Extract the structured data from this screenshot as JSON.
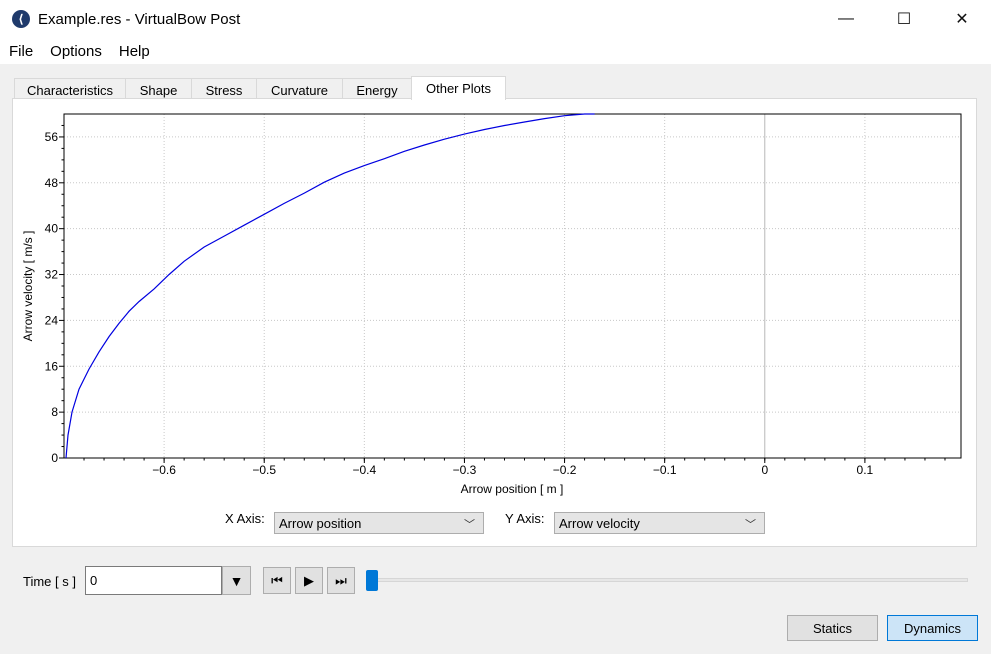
{
  "window": {
    "title": "Example.res - VirtualBow Post",
    "minimize_glyph": "—",
    "maximize_glyph": "☐",
    "close_glyph": "✕",
    "logo_icon": "virtualbow-logo-icon"
  },
  "menu": [
    {
      "label": "File"
    },
    {
      "label": "Options"
    },
    {
      "label": "Help"
    }
  ],
  "tabs": [
    {
      "label": "Characteristics",
      "active": false
    },
    {
      "label": "Shape",
      "active": false
    },
    {
      "label": "Stress",
      "active": false
    },
    {
      "label": "Curvature",
      "active": false
    },
    {
      "label": "Energy",
      "active": false
    },
    {
      "label": "Other Plots",
      "active": true
    }
  ],
  "axis_selectors": {
    "x_label": "X Axis:",
    "x_value": "Arrow position",
    "y_label": "Y Axis:",
    "y_value": "Arrow velocity"
  },
  "time": {
    "label": "Time [ s ]",
    "value": "0",
    "slider_fraction": 0.0
  },
  "buttons": {
    "statics": "Statics",
    "dynamics": "Dynamics"
  },
  "colors": {
    "curve": "#0000e0",
    "slider": "#0078d7"
  },
  "chart_data": {
    "type": "line",
    "xlabel": "Arrow position [ m ]",
    "ylabel": "Arrow velocity [ m/s ]",
    "xlim": [
      -0.7,
      0.196
    ],
    "ylim": [
      0,
      60
    ],
    "xticks": [
      -0.6,
      -0.5,
      -0.4,
      -0.3,
      -0.2,
      -0.1,
      0,
      0.1
    ],
    "xtick_labels": [
      "−0.6",
      "−0.5",
      "−0.4",
      "−0.3",
      "−0.2",
      "−0.1",
      "0",
      "0.1"
    ],
    "yticks": [
      0,
      8,
      16,
      24,
      32,
      40,
      48,
      56
    ],
    "ytick_labels": [
      "0",
      "8",
      "16",
      "24",
      "32",
      "40",
      "48",
      "56"
    ],
    "grid": true,
    "series": [
      {
        "x": [
          -0.698,
          -0.696,
          -0.692,
          -0.685,
          -0.675,
          -0.665,
          -0.655,
          -0.645,
          -0.635,
          -0.625,
          -0.61,
          -0.595,
          -0.58,
          -0.56,
          -0.54,
          -0.52,
          -0.5,
          -0.48,
          -0.46,
          -0.44,
          -0.42,
          -0.4,
          -0.38,
          -0.36,
          -0.34,
          -0.32,
          -0.3,
          -0.28,
          -0.26,
          -0.24,
          -0.22,
          -0.2,
          -0.18,
          -0.17
        ],
        "y": [
          0,
          4,
          8,
          12,
          15.5,
          18.5,
          21.2,
          23.5,
          25.6,
          27.3,
          29.5,
          32,
          34.3,
          36.8,
          38.7,
          40.6,
          42.5,
          44.4,
          46.2,
          48.1,
          49.7,
          51,
          52.2,
          53.5,
          54.6,
          55.6,
          56.5,
          57.3,
          58,
          58.6,
          59.2,
          59.7,
          60,
          60.1
        ]
      }
    ]
  }
}
